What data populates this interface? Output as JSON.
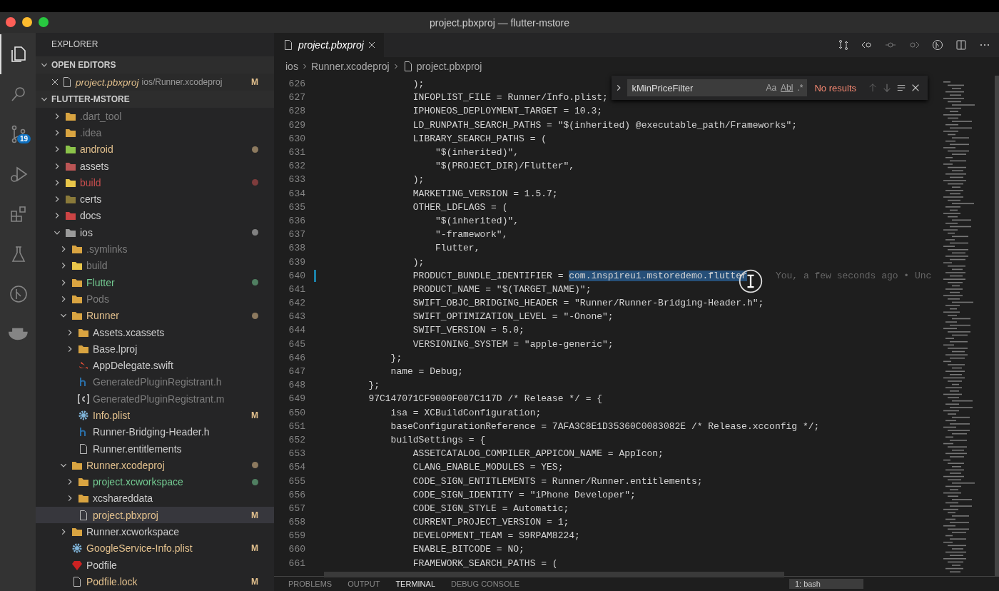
{
  "window": {
    "title": "project.pbxproj — flutter-mstore"
  },
  "activity_bar": [
    {
      "kind": "explorer",
      "selected": true
    },
    {
      "kind": "search",
      "selected": false
    },
    {
      "kind": "source-control",
      "selected": false,
      "badge": "19"
    },
    {
      "kind": "debug",
      "selected": false
    },
    {
      "kind": "extensions",
      "selected": false
    },
    {
      "kind": "testing",
      "selected": false
    },
    {
      "kind": "git-graph",
      "selected": false
    },
    {
      "kind": "docker",
      "selected": false
    }
  ],
  "sidebar": {
    "title": "EXPLORER",
    "open_editors": {
      "title": "OPEN EDITORS",
      "expanded": true,
      "items": [
        {
          "name": "project.pbxproj",
          "path": "ios/Runner.xcodeproj",
          "badge": "M",
          "color": "#e2c08d"
        }
      ]
    },
    "folder": {
      "title": "FLUTTER-MSTORE",
      "expanded": true,
      "items": [
        {
          "label": ".dart_tool",
          "kind": "folder",
          "color": "#7d7d7d",
          "expanded": false,
          "selected": false,
          "dot": false
        },
        {
          "label": ".idea",
          "kind": "idea-folder",
          "color": "#7d7d7d",
          "expanded": false,
          "selected": false,
          "dot": false
        },
        {
          "label": "android",
          "kind": "android-folder",
          "color": "#e2c08d",
          "expanded": false,
          "selected": false,
          "dot": true
        },
        {
          "label": "assets",
          "kind": "assets-folder",
          "color": "#cccccc",
          "expanded": false,
          "selected": false,
          "dot": false
        },
        {
          "label": "build",
          "kind": "build-folder",
          "color": "#c74e4e",
          "expanded": false,
          "selected": false,
          "dot": true
        },
        {
          "label": "certs",
          "kind": "certs-folder",
          "color": "#cccccc",
          "expanded": false,
          "selected": false,
          "dot": false
        },
        {
          "label": "docs",
          "kind": "docs-folder",
          "color": "#cccccc",
          "expanded": false,
          "selected": false,
          "dot": false
        },
        {
          "label": "ios",
          "kind": "ios-folder",
          "color": "#cccccc",
          "expanded": true,
          "selected": false,
          "dot": true,
          "children": [
            {
              "label": ".symlinks",
              "kind": "folder",
              "color": "#7d7d7d",
              "expanded": false,
              "selected": false,
              "dot": false
            },
            {
              "label": "build",
              "kind": "build-folder",
              "color": "#7d7d7d",
              "expanded": false,
              "selected": false,
              "dot": false
            },
            {
              "label": "Flutter",
              "kind": "folder",
              "color": "#73c991",
              "expanded": false,
              "selected": false,
              "dot": true
            },
            {
              "label": "Pods",
              "kind": "folder",
              "color": "#7d7d7d",
              "expanded": false,
              "selected": false,
              "dot": false
            },
            {
              "label": "Runner",
              "kind": "folder",
              "color": "#e2c08d",
              "expanded": true,
              "selected": false,
              "dot": true,
              "children": [
                {
                  "label": "Assets.xcassets",
                  "kind": "folder",
                  "color": "#cccccc",
                  "expanded": false,
                  "selected": false,
                  "dot": false
                },
                {
                  "label": "Base.lproj",
                  "kind": "folder",
                  "color": "#cccccc",
                  "expanded": false,
                  "selected": false,
                  "dot": false
                },
                {
                  "label": "AppDelegate.swift",
                  "kind": "swift",
                  "color": "#cccccc",
                  "selected": false,
                  "dot": false
                },
                {
                  "label": "GeneratedPluginRegistrant.h",
                  "kind": "header",
                  "color": "#7d7d7d",
                  "selected": false,
                  "dot": false
                },
                {
                  "label": "GeneratedPluginRegistrant.m",
                  "kind": "objc",
                  "color": "#7d7d7d",
                  "selected": false,
                  "dot": false
                },
                {
                  "label": "Info.plist",
                  "kind": "gear",
                  "color": "#e2c08d",
                  "selected": false,
                  "dot": false,
                  "badge": "M"
                },
                {
                  "label": "Runner-Bridging-Header.h",
                  "kind": "header",
                  "color": "#cccccc",
                  "selected": false,
                  "dot": false
                },
                {
                  "label": "Runner.entitlements",
                  "kind": "file",
                  "color": "#cccccc",
                  "selected": false,
                  "dot": false
                }
              ]
            },
            {
              "label": "Runner.xcodeproj",
              "kind": "folder",
              "color": "#e2c08d",
              "expanded": true,
              "selected": false,
              "dot": true,
              "children": [
                {
                  "label": "project.xcworkspace",
                  "kind": "folder",
                  "color": "#73c991",
                  "expanded": false,
                  "selected": false,
                  "dot": true
                },
                {
                  "label": "xcshareddata",
                  "kind": "folder",
                  "color": "#cccccc",
                  "expanded": false,
                  "selected": false,
                  "dot": false
                },
                {
                  "label": "project.pbxproj",
                  "kind": "file",
                  "color": "#e2c08d",
                  "selected": true,
                  "dot": false,
                  "badge": "M"
                }
              ]
            },
            {
              "label": "Runner.xcworkspace",
              "kind": "folder",
              "color": "#cccccc",
              "expanded": false,
              "selected": false,
              "dot": false
            },
            {
              "label": "GoogleService-Info.plist",
              "kind": "gear",
              "color": "#e2c08d",
              "selected": false,
              "dot": false,
              "badge": "M"
            },
            {
              "label": "Podfile",
              "kind": "ruby",
              "color": "#cccccc",
              "selected": false,
              "dot": false
            },
            {
              "label": "Podfile.lock",
              "kind": "file",
              "color": "#e2c08d",
              "selected": false,
              "dot": false,
              "badge": "M"
            }
          ]
        }
      ]
    }
  },
  "editor": {
    "tab": {
      "label": "project.pbxproj",
      "selected": true
    },
    "breadcrumbs": [
      "ios",
      "Runner.xcodeproj",
      "project.pbxproj"
    ],
    "find": {
      "value": "kMinPriceFilter",
      "match_case": "Aa",
      "whole_word": "Abl",
      "regex": ".*",
      "result": "No results"
    },
    "lines": [
      {
        "n": "626",
        "text": "                );",
        "modified": false
      },
      {
        "n": "627",
        "text": "                INFOPLIST_FILE = Runner/Info.plist;",
        "modified": false
      },
      {
        "n": "628",
        "text": "                IPHONEOS_DEPLOYMENT_TARGET = 10.3;",
        "modified": false
      },
      {
        "n": "629",
        "text": "                LD_RUNPATH_SEARCH_PATHS = \"$(inherited) @executable_path/Frameworks\";",
        "modified": false
      },
      {
        "n": "630",
        "text": "                LIBRARY_SEARCH_PATHS = (",
        "modified": false
      },
      {
        "n": "631",
        "text": "                    \"$(inherited)\",",
        "modified": false
      },
      {
        "n": "632",
        "text": "                    \"$(PROJECT_DIR)/Flutter\",",
        "modified": false
      },
      {
        "n": "633",
        "text": "                );",
        "modified": false
      },
      {
        "n": "634",
        "text": "                MARKETING_VERSION = 1.5.7;",
        "modified": false
      },
      {
        "n": "635",
        "text": "                OTHER_LDFLAGS = (",
        "modified": false
      },
      {
        "n": "636",
        "text": "                    \"$(inherited)\",",
        "modified": false
      },
      {
        "n": "637",
        "text": "                    \"-framework\",",
        "modified": false
      },
      {
        "n": "638",
        "text": "                    Flutter,",
        "modified": false
      },
      {
        "n": "639",
        "text": "                );",
        "modified": false
      },
      {
        "n": "640",
        "text": "                PRODUCT_BUNDLE_IDENTIFIER = ",
        "highlight": "com.inspireui.mstoredemo.flutter",
        "blame": "You, a few seconds ago • Unc",
        "modified": true
      },
      {
        "n": "641",
        "text": "                PRODUCT_NAME = \"$(TARGET_NAME)\";",
        "modified": false
      },
      {
        "n": "642",
        "text": "                SWIFT_OBJC_BRIDGING_HEADER = \"Runner/Runner-Bridging-Header.h\";",
        "modified": false
      },
      {
        "n": "643",
        "text": "                SWIFT_OPTIMIZATION_LEVEL = \"-Onone\";",
        "modified": false
      },
      {
        "n": "644",
        "text": "                SWIFT_VERSION = 5.0;",
        "modified": false
      },
      {
        "n": "645",
        "text": "                VERSIONING_SYSTEM = \"apple-generic\";",
        "modified": false
      },
      {
        "n": "646",
        "text": "            };",
        "modified": false
      },
      {
        "n": "647",
        "text": "            name = Debug;",
        "modified": false
      },
      {
        "n": "648",
        "text": "        };",
        "modified": false
      },
      {
        "n": "649",
        "text": "        97C147071CF9000F007C117D /* Release */ = {",
        "modified": false
      },
      {
        "n": "650",
        "text": "            isa = XCBuildConfiguration;",
        "modified": false
      },
      {
        "n": "651",
        "text": "            baseConfigurationReference = 7AFA3C8E1D35360C0083082E /* Release.xcconfig */;",
        "modified": false
      },
      {
        "n": "652",
        "text": "            buildSettings = {",
        "modified": false
      },
      {
        "n": "653",
        "text": "                ASSETCATALOG_COMPILER_APPICON_NAME = AppIcon;",
        "modified": false
      },
      {
        "n": "654",
        "text": "                CLANG_ENABLE_MODULES = YES;",
        "modified": false
      },
      {
        "n": "655",
        "text": "                CODE_SIGN_ENTITLEMENTS = Runner/Runner.entitlements;",
        "modified": false
      },
      {
        "n": "656",
        "text": "                CODE_SIGN_IDENTITY = \"iPhone Developer\";",
        "modified": false
      },
      {
        "n": "657",
        "text": "                CODE_SIGN_STYLE = Automatic;",
        "modified": false
      },
      {
        "n": "658",
        "text": "                CURRENT_PROJECT_VERSION = 1;",
        "modified": false
      },
      {
        "n": "659",
        "text": "                DEVELOPMENT_TEAM = S9RPAM8224;",
        "modified": false
      },
      {
        "n": "660",
        "text": "                ENABLE_BITCODE = NO;",
        "modified": false
      },
      {
        "n": "661",
        "text": "                FRAMEWORK_SEARCH_PATHS = (",
        "modified": false
      }
    ]
  },
  "panel": {
    "tabs": [
      {
        "label": "PROBLEMS",
        "selected": false
      },
      {
        "label": "OUTPUT",
        "selected": false
      },
      {
        "label": "TERMINAL",
        "selected": true
      },
      {
        "label": "DEBUG CONSOLE",
        "selected": false
      }
    ],
    "terminal_select": "1: bash"
  }
}
